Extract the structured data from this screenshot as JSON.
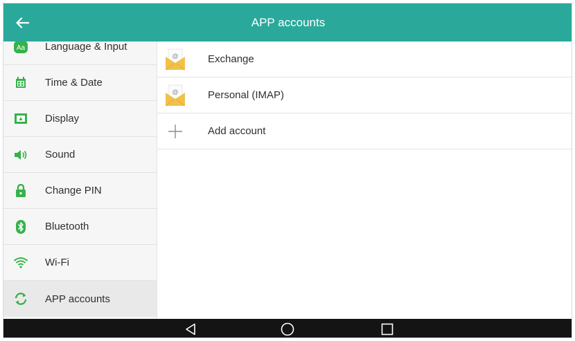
{
  "header": {
    "title": "APP accounts",
    "back_icon": "arrow-left-icon"
  },
  "sidebar": {
    "items": [
      {
        "label": "Language & Input",
        "icon": "language-icon",
        "active": false
      },
      {
        "label": "Time & Date",
        "icon": "calendar-icon",
        "active": false
      },
      {
        "label": "Display",
        "icon": "display-icon",
        "active": false
      },
      {
        "label": "Sound",
        "icon": "speaker-icon",
        "active": false
      },
      {
        "label": "Change PIN",
        "icon": "lock-icon",
        "active": false
      },
      {
        "label": "Bluetooth",
        "icon": "bluetooth-icon",
        "active": false
      },
      {
        "label": "Wi-Fi",
        "icon": "wifi-icon",
        "active": false
      },
      {
        "label": "APP accounts",
        "icon": "sync-icon",
        "active": true
      }
    ]
  },
  "accounts": [
    {
      "label": "Exchange",
      "icon": "email-envelope-icon"
    },
    {
      "label": "Personal (IMAP)",
      "icon": "email-envelope-icon"
    },
    {
      "label": "Add account",
      "icon": "plus-icon"
    }
  ],
  "navbar": {
    "buttons": [
      "back-triangle-icon",
      "home-circle-icon",
      "recents-square-icon"
    ]
  },
  "colors": {
    "accent": "#2aa99b",
    "icon_green": "#36b24a",
    "navbar": "#141414",
    "envelope": "#f1c14a"
  }
}
